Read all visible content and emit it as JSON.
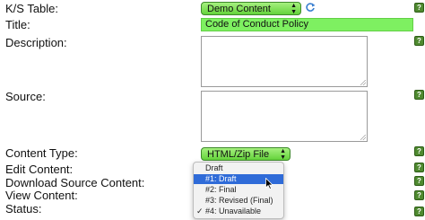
{
  "labels": {
    "ks_table": "K/S Table:",
    "title": "Title:",
    "description": "Description:",
    "source": "Source:",
    "content_type": "Content Type:",
    "edit_content": "Edit Content:",
    "download_source": "Download Source Content:",
    "view_content": "View Content:",
    "status": "Status:"
  },
  "ks_table_select": {
    "value": "Demo Content"
  },
  "title_field": {
    "value": "Code of Conduct Policy"
  },
  "content_type_select": {
    "value": "HTML/Zip File"
  },
  "status_dropdown": {
    "options": [
      "Draft",
      "#1: Draft",
      "#2: Final",
      "#3: Revised (Final)",
      "#4: Unavailable"
    ],
    "highlighted": "#1: Draft",
    "checked": "#4: Unavailable",
    "check_mark": "✓"
  },
  "help_glyph": "?",
  "colors": {
    "field_green": "#7ef061",
    "select_green": "#64d33b",
    "help_green": "#4f8a30",
    "highlight_blue": "#2f6bd8"
  }
}
